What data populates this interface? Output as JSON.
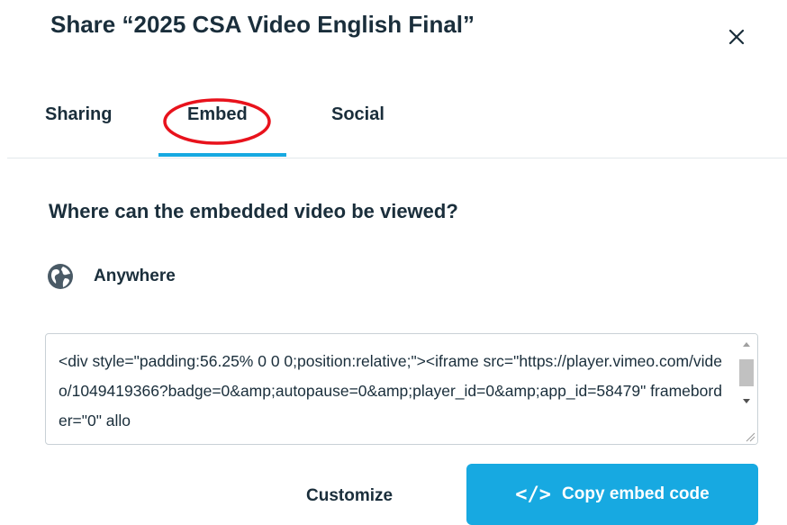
{
  "dialog": {
    "title": "Share “2025 CSA Video English Final”",
    "close_icon": "close-icon"
  },
  "tabs": [
    {
      "label": "Sharing",
      "active": false
    },
    {
      "label": "Embed",
      "active": true
    },
    {
      "label": "Social",
      "active": false
    }
  ],
  "embed": {
    "question": "Where can the embedded video be viewed?",
    "privacy": {
      "icon": "globe-icon",
      "label": "Anywhere"
    },
    "code": "<div style=\"padding:56.25% 0 0 0;position:relative;\"><iframe src=\"https://player.vimeo.com/video/1049419366?badge=0&amp;autopause=0&amp;player_id=0&amp;app_id=58479\" frameborder=\"0\" allo",
    "customize_label": "Customize",
    "copy_icon": "</>",
    "copy_label": "Copy embed code"
  },
  "colors": {
    "accent": "#17a9e1",
    "highlight": "#e8121c",
    "text": "#1a2e3b"
  }
}
